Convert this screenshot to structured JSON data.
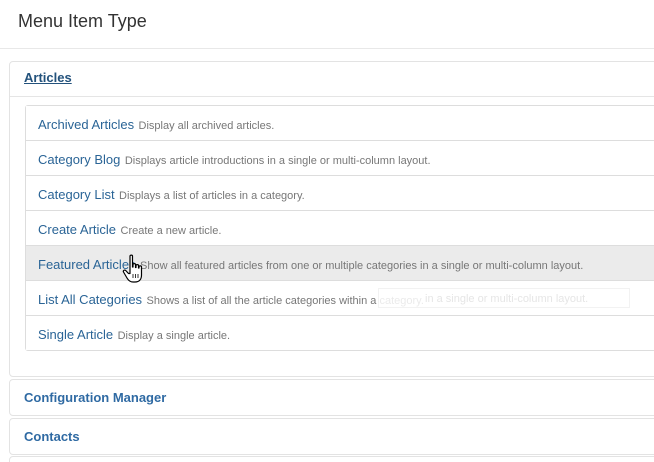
{
  "modal": {
    "title": "Menu Item Type"
  },
  "groups": {
    "articles": {
      "title": "Articles",
      "items": [
        {
          "title": "Archived Articles",
          "description": "Display all archived articles."
        },
        {
          "title": "Category Blog",
          "description": "Displays article introductions in a single or multi-column layout."
        },
        {
          "title": "Category List",
          "description": "Displays a list of articles in a category."
        },
        {
          "title": "Create Article",
          "description": "Create a new article."
        },
        {
          "title": "Featured Articles",
          "description": "Show all featured articles from one or multiple categories in a single or multi-column layout."
        },
        {
          "title": "List All Categories",
          "description": "Shows a list of all the article categories within a category."
        },
        {
          "title": "Single Article",
          "description": "Display a single article."
        }
      ],
      "hovered_item": "Featured Articles",
      "tooltip_ghost_text": "in a single or multi-column layout."
    },
    "configuration_manager": {
      "title": "Configuration Manager"
    },
    "contacts": {
      "title": "Contacts"
    }
  },
  "colors": {
    "link": "#2a6496",
    "heading_link": "#23527c",
    "hover_row": "#ebebeb",
    "border": "#dddddd"
  },
  "icons": {
    "cursor": "hand-pointer-icon"
  }
}
